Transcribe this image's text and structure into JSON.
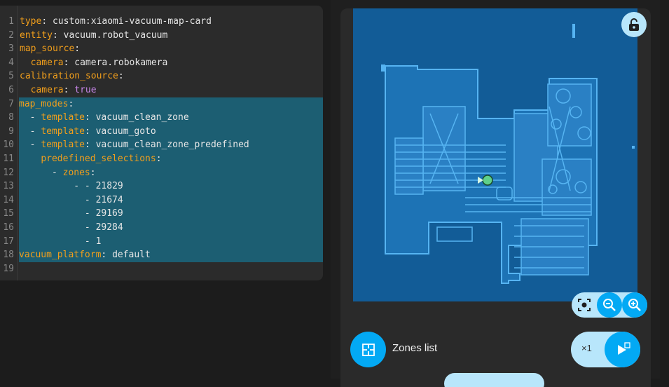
{
  "editor": {
    "lines": [
      {
        "num": "1",
        "key": "type",
        "sep": ": ",
        "value": "custom:xiaomi-vacuum-map-card"
      },
      {
        "num": "2",
        "key": "entity",
        "sep": ": ",
        "value": "vacuum.robot_vacuum"
      },
      {
        "num": "3",
        "key": "map_source",
        "sep": ":",
        "value": ""
      },
      {
        "num": "4",
        "key": "camera",
        "sep": ": ",
        "value": "camera.robokamera",
        "indent": "  "
      },
      {
        "num": "5",
        "key": "calibration_source",
        "sep": ":",
        "value": ""
      },
      {
        "num": "6",
        "key": "camera",
        "sep": ": ",
        "value": "true",
        "indent": "  "
      },
      {
        "num": "7",
        "key": "map_modes",
        "sep": ":",
        "value": ""
      },
      {
        "num": "8",
        "key": "template",
        "sep": ": ",
        "value": "vacuum_clean_zone",
        "indent": "  - "
      },
      {
        "num": "9",
        "key": "template",
        "sep": ": ",
        "value": "vacuum_goto",
        "indent": "  - "
      },
      {
        "num": "10",
        "key": "template",
        "sep": ": ",
        "value": "vacuum_clean_zone_predefined",
        "indent": "  - "
      },
      {
        "num": "11",
        "key": "predefined_selections",
        "sep": ":",
        "value": "",
        "indent": "    "
      },
      {
        "num": "12",
        "key": "zones",
        "sep": ":",
        "value": "",
        "indent": "      - "
      },
      {
        "num": "13",
        "key": "",
        "sep": "",
        "value": "- - 21829",
        "indent": "          "
      },
      {
        "num": "14",
        "key": "",
        "sep": "",
        "value": "- 21674",
        "indent": "            "
      },
      {
        "num": "15",
        "key": "",
        "sep": "",
        "value": "- 29169",
        "indent": "            "
      },
      {
        "num": "16",
        "key": "",
        "sep": "",
        "value": "- 29284",
        "indent": "            "
      },
      {
        "num": "17",
        "key": "",
        "sep": "",
        "value": "- 1",
        "indent": "            "
      },
      {
        "num": "18",
        "key": "vacuum_platform",
        "sep": ": ",
        "value": "default"
      },
      {
        "num": "19",
        "key": "",
        "sep": "",
        "value": ""
      }
    ]
  },
  "card": {
    "zones_label": "Zones list",
    "repeat_count": "×1"
  },
  "colors": {
    "accent": "#03a9f4",
    "accent_light": "#b8e6fb",
    "map_background": "#125c97",
    "map_floor": "#1d73b5",
    "map_walls": "#56b4f2",
    "yaml_key": "#f29f1b",
    "selection": "#1c5e72"
  },
  "icons": {
    "lock": "lock-open-icon",
    "center": "crosshair-icon",
    "zoom_out": "zoom-out-icon",
    "zoom_in": "zoom-in-icon",
    "zones": "floor-plan-icon",
    "start": "play-icon"
  }
}
